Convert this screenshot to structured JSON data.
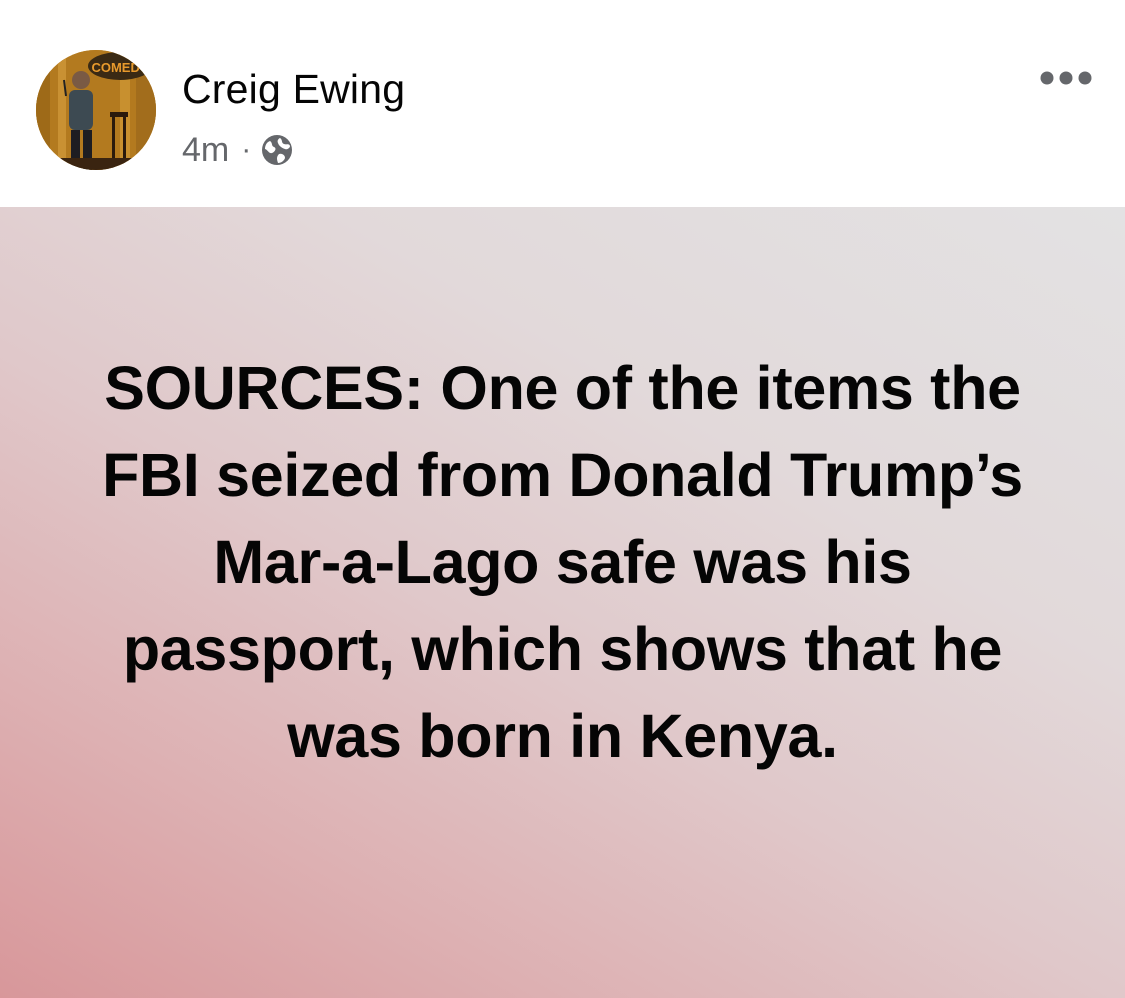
{
  "post": {
    "author_name": "Creig Ewing",
    "timestamp": "4m",
    "separator": "·",
    "audience_icon": "globe-icon",
    "more_icon": "more-options-icon",
    "body_text": "SOURCES: One of the items the FBI seized from Donald Trump’s Mar-a-Lago safe was his passport, which shows that he was born in Kenya.",
    "avatar_sign_text": "COMEDY"
  },
  "colors": {
    "text_primary": "#050505",
    "text_secondary": "#65676b",
    "background_gradient_start": "#d8979a",
    "background_gradient_end": "#e3e2e3"
  }
}
